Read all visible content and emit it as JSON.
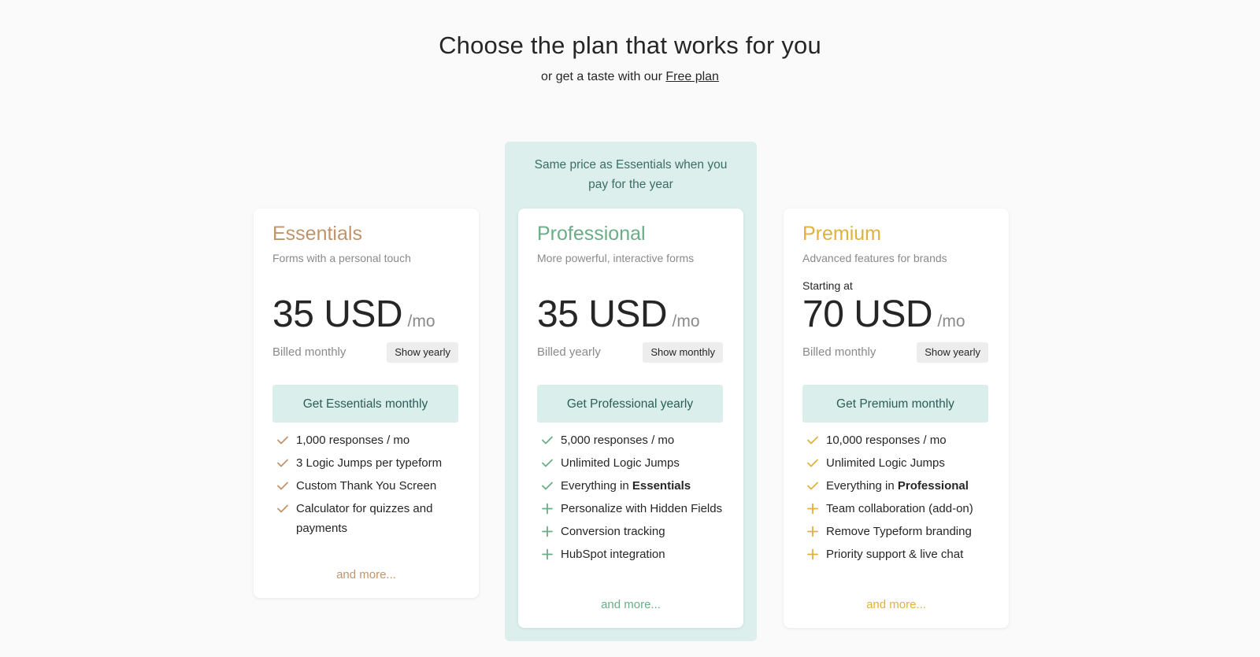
{
  "header": {
    "title": "Choose the plan that works for you",
    "subtitle_prefix": "or get a taste with our ",
    "free_plan_link": "Free plan"
  },
  "highlight": {
    "line1": "Same price as Essentials when you",
    "line2": "pay for the year",
    "background_color": "#dcefec"
  },
  "plans": [
    {
      "name": "Essentials",
      "accent_color": "#c0946b",
      "description": "Forms with a personal touch",
      "starting_at": "",
      "price": "35 USD",
      "unit": "/mo",
      "billing": "Billed monthly",
      "toggle_label": "Show yearly",
      "cta_label": "Get Essentials monthly",
      "features": [
        {
          "icon": "check-icon",
          "text": "1,000 responses / mo",
          "bold": ""
        },
        {
          "icon": "check-icon",
          "text": "3 Logic Jumps per typeform",
          "bold": ""
        },
        {
          "icon": "check-icon",
          "text": "Custom Thank You Screen",
          "bold": ""
        },
        {
          "icon": "check-icon",
          "text": "Calculator for quizzes and payments",
          "bold": ""
        }
      ],
      "more_label": "and more..."
    },
    {
      "name": "Professional",
      "accent_color": "#6aae86",
      "description": "More powerful, interactive forms",
      "starting_at": "",
      "price": "35 USD",
      "unit": "/mo",
      "billing": "Billed yearly",
      "toggle_label": "Show monthly",
      "cta_label": "Get Professional yearly",
      "features": [
        {
          "icon": "check-icon",
          "text": "5,000 responses / mo",
          "bold": ""
        },
        {
          "icon": "check-icon",
          "text": "Unlimited Logic Jumps",
          "bold": ""
        },
        {
          "icon": "check-icon",
          "text": "Everything in ",
          "bold": "Essentials"
        },
        {
          "icon": "plus-icon",
          "text": "Personalize with Hidden Fields",
          "bold": ""
        },
        {
          "icon": "plus-icon",
          "text": "Conversion tracking",
          "bold": ""
        },
        {
          "icon": "plus-icon",
          "text": "HubSpot integration",
          "bold": ""
        }
      ],
      "more_label": "and more..."
    },
    {
      "name": "Premium",
      "accent_color": "#e0b13d",
      "description": "Advanced features for brands",
      "starting_at": "Starting at",
      "price": "70 USD",
      "unit": "/mo",
      "billing": "Billed monthly",
      "toggle_label": "Show yearly",
      "cta_label": "Get Premium monthly",
      "features": [
        {
          "icon": "check-icon",
          "text": "10,000 responses / mo",
          "bold": ""
        },
        {
          "icon": "check-icon",
          "text": "Unlimited Logic Jumps",
          "bold": ""
        },
        {
          "icon": "check-icon",
          "text": "Everything in ",
          "bold": "Professional"
        },
        {
          "icon": "plus-icon",
          "text": "Team collaboration (add-on)",
          "bold": ""
        },
        {
          "icon": "plus-icon",
          "text": "Remove Typeform branding",
          "bold": ""
        },
        {
          "icon": "plus-icon",
          "text": "Priority support & live chat",
          "bold": ""
        }
      ],
      "more_label": "and more..."
    }
  ]
}
